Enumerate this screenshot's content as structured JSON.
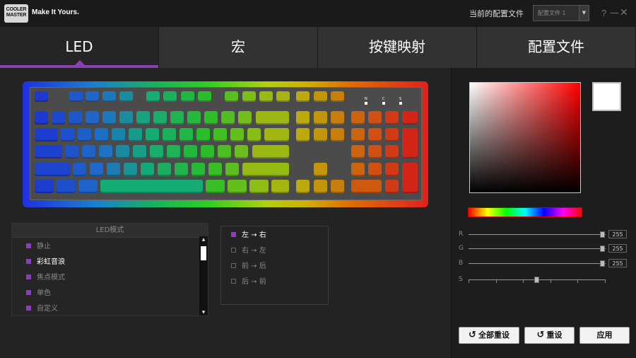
{
  "titlebar": {
    "logo_text": "COOLER MASTER",
    "slogan": "Make It Yours.",
    "profile_label": "当前的配置文件",
    "profile_value": "配置文件 1"
  },
  "tabs": [
    {
      "label": "LED",
      "active": true
    },
    {
      "label": "宏",
      "active": false
    },
    {
      "label": "按键映射",
      "active": false
    },
    {
      "label": "配置文件",
      "active": false
    }
  ],
  "keyboard": {
    "indicators": [
      "N",
      "C",
      "S"
    ]
  },
  "led_mode": {
    "header": "LED模式",
    "items": [
      {
        "label": "静止",
        "selected": false
      },
      {
        "label": "彩虹音浪",
        "selected": true
      },
      {
        "label": "焦点模式",
        "selected": false
      },
      {
        "label": "单色",
        "selected": false
      },
      {
        "label": "自定义",
        "selected": false
      }
    ]
  },
  "direction": {
    "items": [
      {
        "label": "左 → 右",
        "checked": true
      },
      {
        "label": "右 → 左",
        "checked": false
      },
      {
        "label": "前 → 后",
        "checked": false
      },
      {
        "label": "后 → 前",
        "checked": false
      }
    ]
  },
  "color": {
    "preview": "#ffffff",
    "sliders": [
      {
        "label": "R",
        "value": "255",
        "level": 1.0
      },
      {
        "label": "G",
        "value": "255",
        "level": 1.0
      },
      {
        "label": "B",
        "value": "255",
        "level": 1.0
      },
      {
        "label": "S",
        "value": "",
        "level": 0.5
      }
    ]
  },
  "buttons": {
    "reset_all": "全部重设",
    "reset": "重设",
    "apply": "应用"
  },
  "colors": {
    "accent": "#8a3fb8"
  }
}
